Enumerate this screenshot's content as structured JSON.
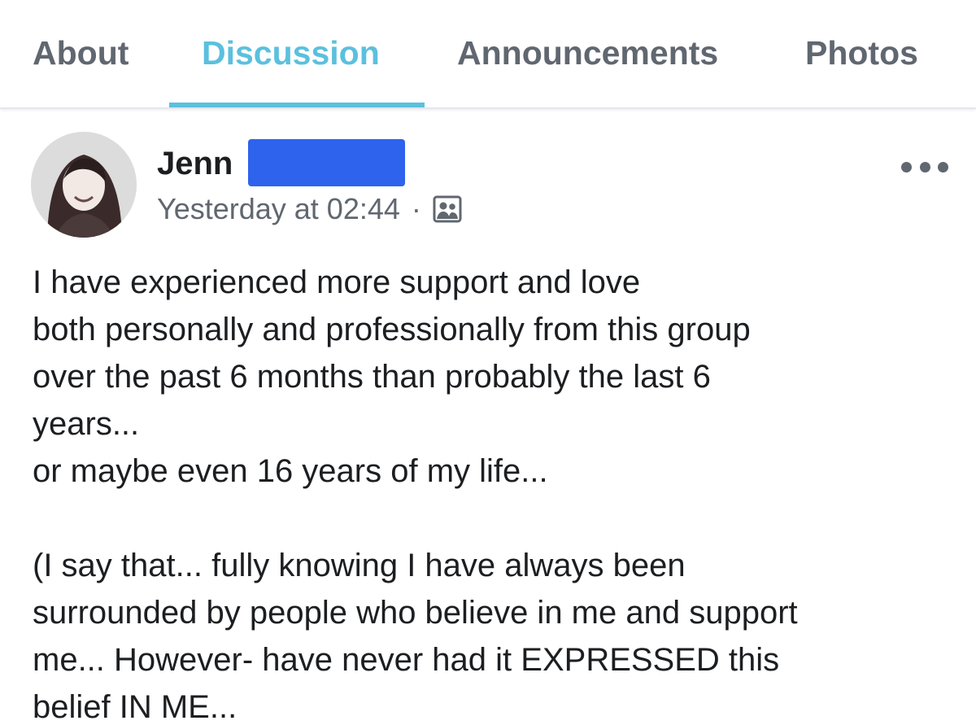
{
  "tabs": [
    {
      "label": "About",
      "active": false
    },
    {
      "label": "Discussion",
      "active": true
    },
    {
      "label": "Announcements",
      "active": false
    },
    {
      "label": "Photos",
      "active": false
    }
  ],
  "colors": {
    "accent": "#5bc0de",
    "redaction": "#2d63ed",
    "muted_text": "#606770"
  },
  "post": {
    "author_first_name": "Jenn",
    "timestamp": "Yesterday at 02:44",
    "separator": "·",
    "audience_icon": "group-members-icon",
    "more_icon": "more-options-icon",
    "body_lines": [
      "I have experienced more support and love",
      "both personally and professionally from this group",
      "over the past 6 months than probably the last 6",
      "years...",
      "or maybe even 16 years of my life...",
      "",
      "(I say that... fully knowing I have always been",
      "surrounded by people who believe in me and support",
      "me... However-  have never had it EXPRESSED this",
      "belief IN ME..."
    ]
  }
}
